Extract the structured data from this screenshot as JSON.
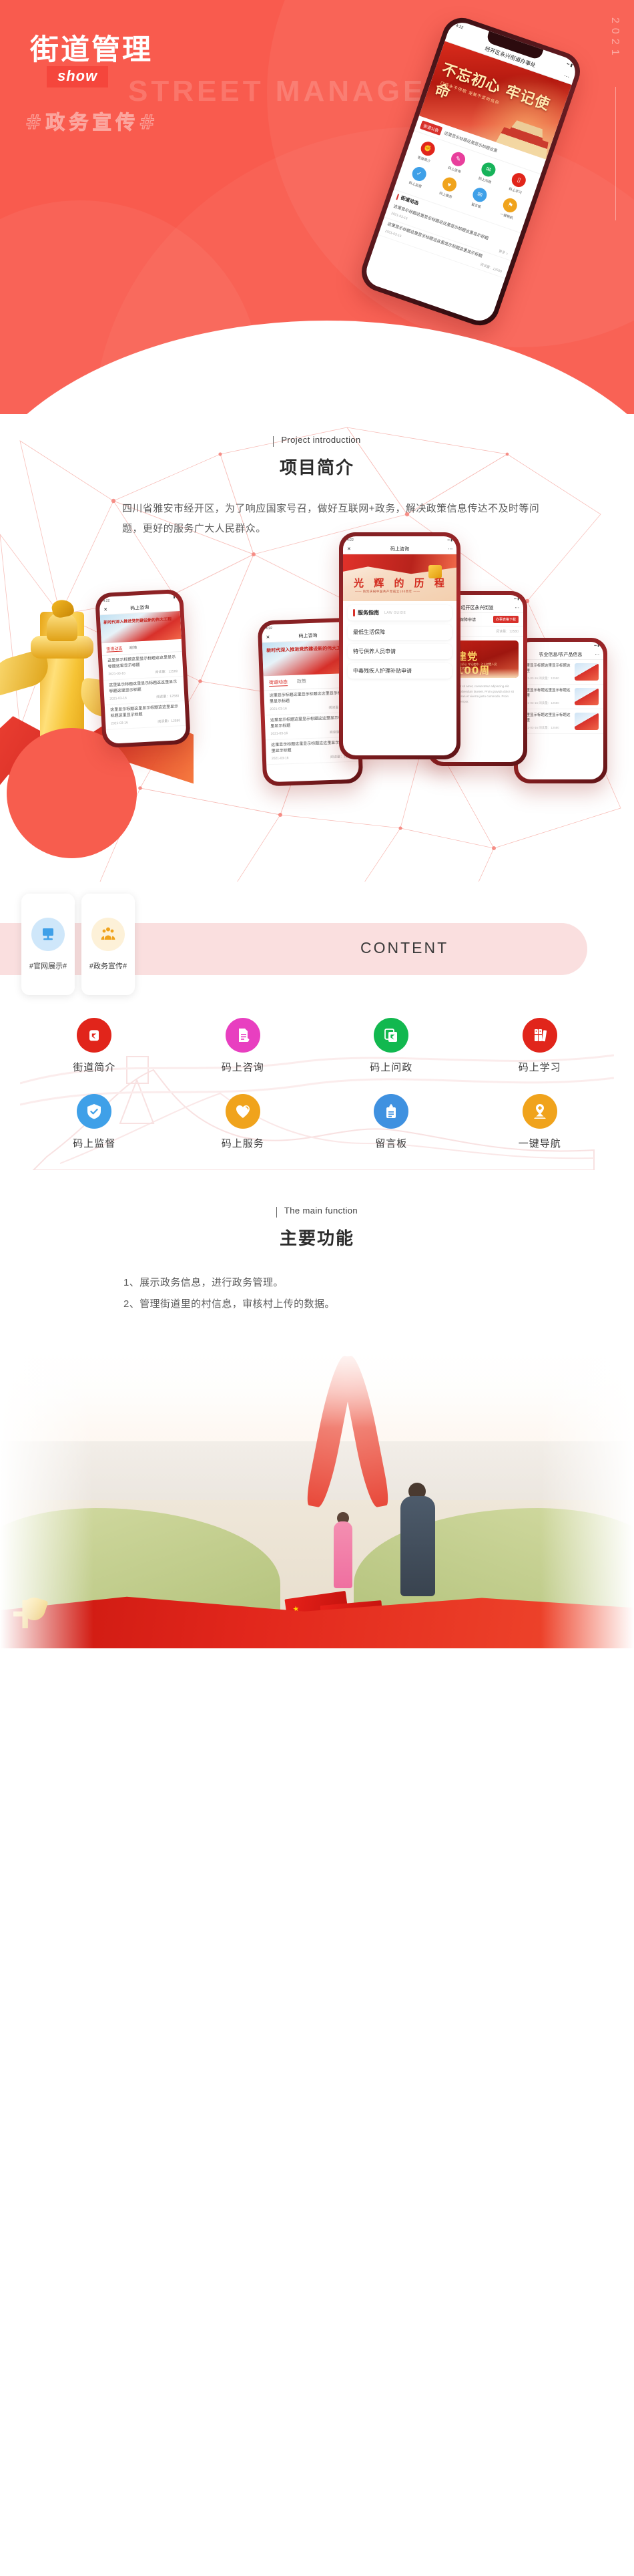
{
  "hero": {
    "year": "2021",
    "title": "街道管理",
    "badge": "show",
    "watermark": "STREET MANAGEMENT",
    "hashtag": "#政务宣传#",
    "phone": {
      "status_time": "4:22",
      "nav_title": "经开区永兴街道办事处",
      "banner_title": "不忘初心 牢记使命",
      "banner_sub": "口袋永不停歇 凝聚不变的信仰",
      "news_tag": "街道公告",
      "news_text": "这里显示标题这里显示标题这里",
      "section_title": "街道动态",
      "section_more": "更多 >",
      "icons": [
        {
          "label": "街道简介",
          "color": "#e1251b",
          "glyph": "✊"
        },
        {
          "label": "码上咨询",
          "color": "#e83f9c",
          "glyph": "✎"
        },
        {
          "label": "码上问政",
          "color": "#17b35a",
          "glyph": "✉"
        },
        {
          "label": "码上学习",
          "color": "#e1251b",
          "glyph": "▯"
        },
        {
          "label": "码上监督",
          "color": "#3fa0e8",
          "glyph": "✓"
        },
        {
          "label": "码上服务",
          "color": "#f0a31c",
          "glyph": "♥"
        },
        {
          "label": "留言板",
          "color": "#3fa0e8",
          "glyph": "✉"
        },
        {
          "label": "一键导航",
          "color": "#f0a31c",
          "glyph": "⚑"
        }
      ],
      "items": [
        {
          "title": "这里显示标题这里显示标题这这里显示标题这里显示标题",
          "date": "2021-03-16",
          "views": "阅读量：12580"
        },
        {
          "title": "这里显示标题这里显示标题这这里显示标题这里显示标题",
          "date": "2021-03-16",
          "views": "阅读量：12580"
        },
        {
          "title": "这里显示标题这里显示标题这这里显示标题这里显示标题",
          "date": "2021-03-16",
          "views": "阅读量：12580"
        }
      ]
    }
  },
  "intro": {
    "eyebrow": "Project introduction",
    "title": "项目简介",
    "body": "四川省雅安市经开区，为了响应国家号召，做好互联网+政务，解决政策信息传达不及时等问题，更好的服务广大人民群众。"
  },
  "showcase": {
    "phone_a": {
      "status_time": "4:22",
      "nav_title": "码上咨询",
      "banner_title": "新时代深入推进党的建设新的伟大工程",
      "banner_sub": "—— 学习",
      "tab": "街道动态",
      "tab2": "政策",
      "items": [
        {
          "title": "这里显示标题这里显示标题这这里显示标题这里显示标题",
          "date": "2021-03-16",
          "views": "阅读量：12580"
        },
        {
          "title": "这里显示标题这里显示标题这这里显示标题这里显示标题",
          "date": "2021-03-16",
          "views": "阅读量：12580"
        },
        {
          "title": "这里显示标题这里显示标题这这里显示标题这里显示标题",
          "date": "2021-03-16",
          "views": "阅读量：12580"
        }
      ]
    },
    "phone_center": {
      "status_time": "4:22",
      "nav_title": "码上咨询",
      "banner_title": "光 辉 的 历 程",
      "banner_sub": "—— 热烈庆祝中国共产党成立100周年 ——",
      "guide_title": "服务指南",
      "guide_en": "LAW GUIDE",
      "rows": [
        "最低生活保障",
        "特亏供养人员申请",
        "中毒残疾人护理补贴申请"
      ]
    },
    "phone_right": {
      "status_time": "4:22",
      "nav_title": "经开区永兴街道",
      "row_title": "申请最低生活保障申请",
      "row_button": "办事表格下载",
      "row_time": "11:42",
      "row_views": "阅读量：12580",
      "news_title": "建党100周年",
      "news_sub": "不忘初心 牢记使命 · 江山就是人民 人民就是江山",
      "paragraph": "Lorem ipsum dolor sit amet, consectetur adipiscing elit. Aenean euismod bibendum laoreet. Proin gravida dolor sit amet lacus accumsan et viverra justo commodo. Proin sodales pulvinar tempor."
    },
    "phone_far_right": {
      "nav_title": "农业信息/农产品信息",
      "items": [
        {
          "title": "这里显示标题这里显示标题这这里",
          "meta": "2021-03-16   阅读量：12580"
        },
        {
          "title": "这里显示标题这里显示标题这这里",
          "meta": "2021-03-16   阅读量：12580"
        },
        {
          "title": "这里显示标题这里显示标题这这里",
          "meta": "2021-03-16   阅读量：12580"
        }
      ]
    }
  },
  "content": {
    "word": "CONTENT",
    "badges": [
      {
        "label": "#官网展示#",
        "icon": "monitor-icon",
        "bg": "#cfe7fa",
        "fg": "#3fa0e8"
      },
      {
        "label": "#政务宣传#",
        "icon": "people-icon",
        "bg": "#fdf1d8",
        "fg": "#f0a31c"
      }
    ],
    "functions": [
      {
        "label": "街道简介",
        "color": "#e1251b",
        "icon": "fist-emblem-icon"
      },
      {
        "label": "码上咨询",
        "color": "#e83fc0",
        "icon": "document-pen-icon"
      },
      {
        "label": "码上问政",
        "color": "#12b84f",
        "icon": "folder-emblem-icon"
      },
      {
        "label": "码上学习",
        "color": "#e1251b",
        "icon": "books-icon"
      },
      {
        "label": "码上监督",
        "color": "#3fa0e8",
        "icon": "shield-check-icon"
      },
      {
        "label": "码上服务",
        "color": "#f0a31c",
        "icon": "heart-hands-icon"
      },
      {
        "label": "留言板",
        "color": "#3f91e0",
        "icon": "clipboard-icon"
      },
      {
        "label": "一键导航",
        "color": "#f0a31c",
        "icon": "location-pin-icon"
      }
    ]
  },
  "main_function": {
    "eyebrow": "The main function",
    "title": "主要功能",
    "items": [
      "1、展示政务信息，进行政务管理。",
      "2、管理街道里的村信息，审核村上传的数据。"
    ]
  }
}
